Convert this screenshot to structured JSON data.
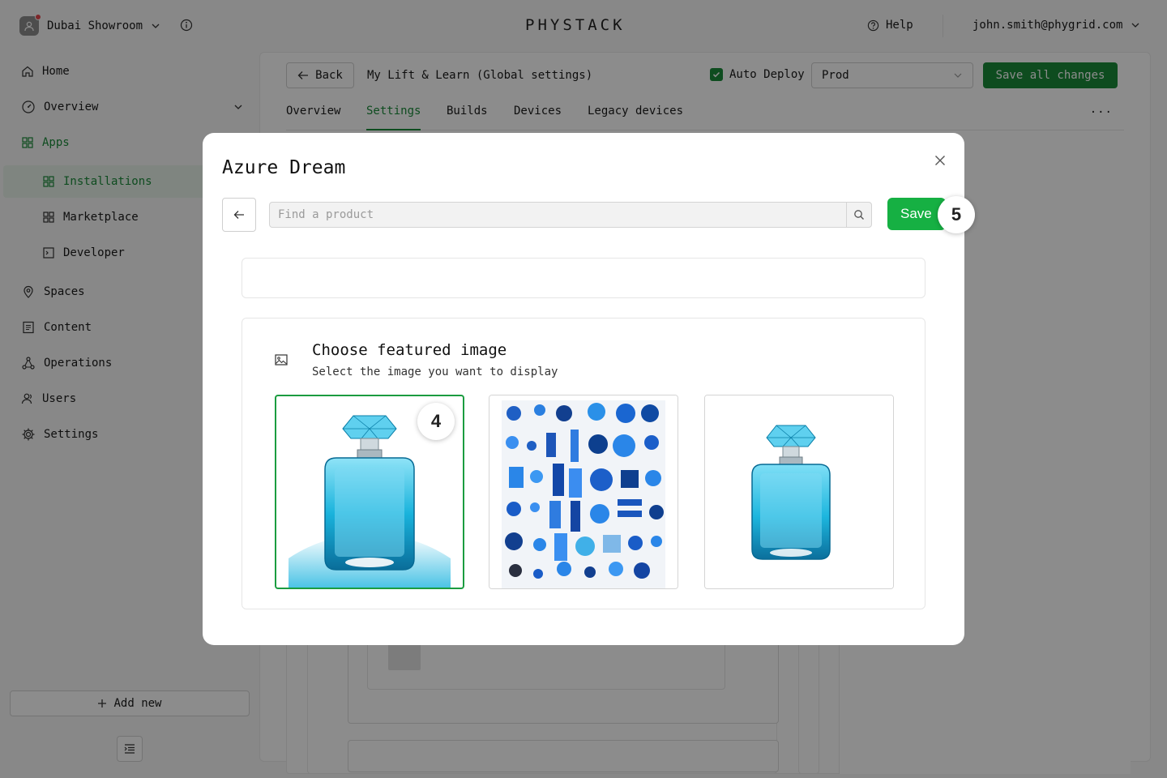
{
  "topbar": {
    "workspace_name": "Dubai Showroom",
    "logo_text": "PHYSTACK",
    "help_label": "Help",
    "user_email": "john.smith@phygrid.com"
  },
  "sidebar": {
    "items": [
      {
        "label": "Home",
        "icon": "home-icon"
      },
      {
        "label": "Overview",
        "icon": "gauge-icon"
      },
      {
        "label": "Apps",
        "icon": "grid-icon"
      },
      {
        "label": "Installations",
        "icon": "grid-icon"
      },
      {
        "label": "Marketplace",
        "icon": "grid-icon"
      },
      {
        "label": "Developer",
        "icon": "terminal-icon"
      },
      {
        "label": "Spaces",
        "icon": "pin-icon"
      },
      {
        "label": "Content",
        "icon": "document-icon"
      },
      {
        "label": "Operations",
        "icon": "network-icon"
      },
      {
        "label": "Users",
        "icon": "users-icon"
      },
      {
        "label": "Settings",
        "icon": "gear-icon"
      }
    ],
    "add_new_label": "Add new"
  },
  "main": {
    "back_label": "Back",
    "app_title": "My Lift & Learn (Global settings)",
    "auto_deploy_label": "Auto Deploy",
    "env_value": "Prod",
    "save_all_label": "Save all changes",
    "tabs": [
      "Overview",
      "Settings",
      "Builds",
      "Devices",
      "Legacy devices"
    ],
    "more_label": "..."
  },
  "modal": {
    "title": "Azure Dream",
    "search_placeholder": "Find a product",
    "save_label": "Save",
    "save_step": "5",
    "featured_title": "Choose featured image",
    "featured_subtitle": "Select the image you want to display",
    "selected_step": "4",
    "images": [
      {
        "name": "perfume-bottle-closeup",
        "selected": true
      },
      {
        "name": "blue-flatlay-collage",
        "selected": false
      },
      {
        "name": "perfume-bottle-small",
        "selected": false
      }
    ]
  },
  "colors": {
    "accent": "#1b8a3a",
    "save_green": "#16b043"
  }
}
